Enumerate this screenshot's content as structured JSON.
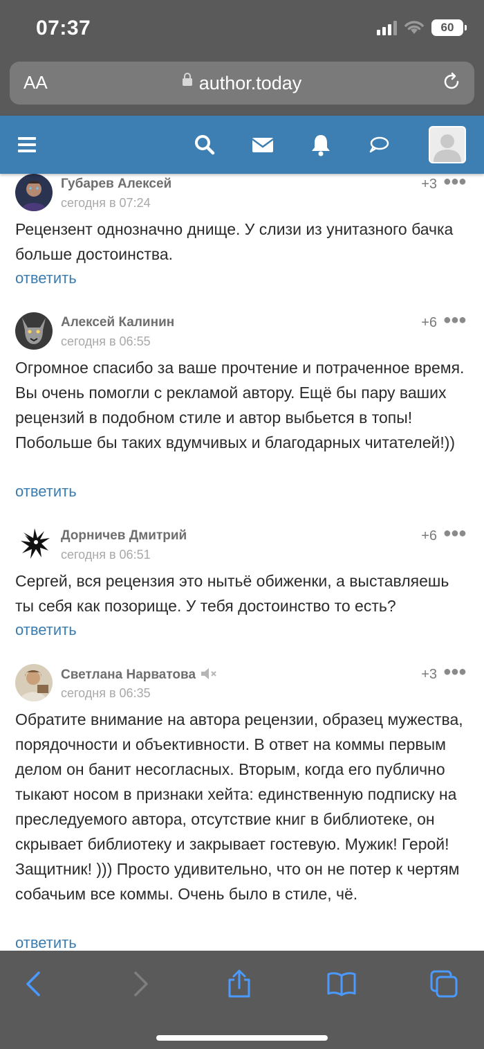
{
  "status_bar": {
    "time": "07:37",
    "battery": "60"
  },
  "browser": {
    "text_size_label": "AA",
    "url": "author.today"
  },
  "comments": [
    {
      "author": "Губарев Алексей",
      "date": "сегодня в 07:24",
      "score": "+3",
      "text": "Рецензент однозначно днище. У слизи из унитазного бачка больше достоинства.",
      "reply": "ответить"
    },
    {
      "author": "Алексей Калинин",
      "date": "сегодня в 06:55",
      "score": "+6",
      "text": "Огромное спасибо за ваше прочтение и потраченное время. Вы очень помогли с рекламой автору. Ещё бы пару ваших рецензий в подобном стиле и автор выбьется в топы! Побольше бы таких вдумчивых и благодарных читателей!))",
      "reply": "ответить"
    },
    {
      "author": "Дорничев Дмитрий",
      "date": "сегодня в 06:51",
      "score": "+6",
      "text": "Сергей, вся рецензия это нытьё обиженки, а выставляешь ты себя как позорище. У тебя достоинство то есть?",
      "reply": "ответить"
    },
    {
      "author": "Светлана Нарватова",
      "date": "сегодня в 06:35",
      "score": "+3",
      "text": "Обратите внимание на автора рецензии, образец мужества, порядочности и объективности. В ответ на коммы первым делом он банит несогласных. Вторым, когда его публично тыкают носом в признаки хейта: единственную подписку на преследуемого автора, отсутствие книг в библиотеке, он скрывает библиотеку и закрывает гостевую. Мужик! Герой! Защитник! ))) Просто удивительно, что он не потер к чертям собачьим все коммы. Очень было в стиле, чё.",
      "reply": "ответить"
    }
  ],
  "colors": {
    "nav": "#3d7fb2",
    "link": "#3b7cb0",
    "chrome": "#5a5a5a"
  },
  "icons": [
    "menu-icon",
    "search-icon",
    "mail-icon",
    "bell-icon",
    "chat-icon",
    "user-avatar-icon",
    "lock-icon",
    "reload-icon",
    "back-icon",
    "forward-icon",
    "share-icon",
    "bookmarks-icon",
    "tabs-icon",
    "mute-icon",
    "more-icon"
  ]
}
